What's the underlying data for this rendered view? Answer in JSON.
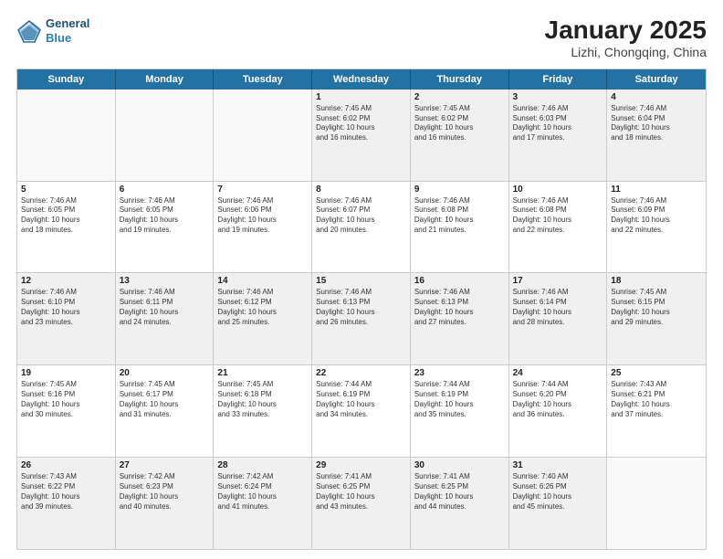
{
  "header": {
    "logo_line1": "General",
    "logo_line2": "Blue",
    "title": "January 2025",
    "subtitle": "Lizhi, Chongqing, China"
  },
  "calendar": {
    "days_of_week": [
      "Sunday",
      "Monday",
      "Tuesday",
      "Wednesday",
      "Thursday",
      "Friday",
      "Saturday"
    ],
    "weeks": [
      {
        "shaded": true,
        "cells": [
          {
            "day": "",
            "empty": true
          },
          {
            "day": "",
            "empty": true
          },
          {
            "day": "",
            "empty": true
          },
          {
            "day": "1",
            "line1": "Sunrise: 7:45 AM",
            "line2": "Sunset: 6:02 PM",
            "line3": "Daylight: 10 hours",
            "line4": "and 16 minutes."
          },
          {
            "day": "2",
            "line1": "Sunrise: 7:45 AM",
            "line2": "Sunset: 6:02 PM",
            "line3": "Daylight: 10 hours",
            "line4": "and 16 minutes."
          },
          {
            "day": "3",
            "line1": "Sunrise: 7:46 AM",
            "line2": "Sunset: 6:03 PM",
            "line3": "Daylight: 10 hours",
            "line4": "and 17 minutes."
          },
          {
            "day": "4",
            "line1": "Sunrise: 7:46 AM",
            "line2": "Sunset: 6:04 PM",
            "line3": "Daylight: 10 hours",
            "line4": "and 18 minutes."
          }
        ]
      },
      {
        "shaded": false,
        "cells": [
          {
            "day": "5",
            "line1": "Sunrise: 7:46 AM",
            "line2": "Sunset: 6:05 PM",
            "line3": "Daylight: 10 hours",
            "line4": "and 18 minutes."
          },
          {
            "day": "6",
            "line1": "Sunrise: 7:46 AM",
            "line2": "Sunset: 6:05 PM",
            "line3": "Daylight: 10 hours",
            "line4": "and 19 minutes."
          },
          {
            "day": "7",
            "line1": "Sunrise: 7:46 AM",
            "line2": "Sunset: 6:06 PM",
            "line3": "Daylight: 10 hours",
            "line4": "and 19 minutes."
          },
          {
            "day": "8",
            "line1": "Sunrise: 7:46 AM",
            "line2": "Sunset: 6:07 PM",
            "line3": "Daylight: 10 hours",
            "line4": "and 20 minutes."
          },
          {
            "day": "9",
            "line1": "Sunrise: 7:46 AM",
            "line2": "Sunset: 6:08 PM",
            "line3": "Daylight: 10 hours",
            "line4": "and 21 minutes."
          },
          {
            "day": "10",
            "line1": "Sunrise: 7:46 AM",
            "line2": "Sunset: 6:08 PM",
            "line3": "Daylight: 10 hours",
            "line4": "and 22 minutes."
          },
          {
            "day": "11",
            "line1": "Sunrise: 7:46 AM",
            "line2": "Sunset: 6:09 PM",
            "line3": "Daylight: 10 hours",
            "line4": "and 22 minutes."
          }
        ]
      },
      {
        "shaded": true,
        "cells": [
          {
            "day": "12",
            "line1": "Sunrise: 7:46 AM",
            "line2": "Sunset: 6:10 PM",
            "line3": "Daylight: 10 hours",
            "line4": "and 23 minutes."
          },
          {
            "day": "13",
            "line1": "Sunrise: 7:46 AM",
            "line2": "Sunset: 6:11 PM",
            "line3": "Daylight: 10 hours",
            "line4": "and 24 minutes."
          },
          {
            "day": "14",
            "line1": "Sunrise: 7:46 AM",
            "line2": "Sunset: 6:12 PM",
            "line3": "Daylight: 10 hours",
            "line4": "and 25 minutes."
          },
          {
            "day": "15",
            "line1": "Sunrise: 7:46 AM",
            "line2": "Sunset: 6:13 PM",
            "line3": "Daylight: 10 hours",
            "line4": "and 26 minutes."
          },
          {
            "day": "16",
            "line1": "Sunrise: 7:46 AM",
            "line2": "Sunset: 6:13 PM",
            "line3": "Daylight: 10 hours",
            "line4": "and 27 minutes."
          },
          {
            "day": "17",
            "line1": "Sunrise: 7:46 AM",
            "line2": "Sunset: 6:14 PM",
            "line3": "Daylight: 10 hours",
            "line4": "and 28 minutes."
          },
          {
            "day": "18",
            "line1": "Sunrise: 7:45 AM",
            "line2": "Sunset: 6:15 PM",
            "line3": "Daylight: 10 hours",
            "line4": "and 29 minutes."
          }
        ]
      },
      {
        "shaded": false,
        "cells": [
          {
            "day": "19",
            "line1": "Sunrise: 7:45 AM",
            "line2": "Sunset: 6:16 PM",
            "line3": "Daylight: 10 hours",
            "line4": "and 30 minutes."
          },
          {
            "day": "20",
            "line1": "Sunrise: 7:45 AM",
            "line2": "Sunset: 6:17 PM",
            "line3": "Daylight: 10 hours",
            "line4": "and 31 minutes."
          },
          {
            "day": "21",
            "line1": "Sunrise: 7:45 AM",
            "line2": "Sunset: 6:18 PM",
            "line3": "Daylight: 10 hours",
            "line4": "and 33 minutes."
          },
          {
            "day": "22",
            "line1": "Sunrise: 7:44 AM",
            "line2": "Sunset: 6:19 PM",
            "line3": "Daylight: 10 hours",
            "line4": "and 34 minutes."
          },
          {
            "day": "23",
            "line1": "Sunrise: 7:44 AM",
            "line2": "Sunset: 6:19 PM",
            "line3": "Daylight: 10 hours",
            "line4": "and 35 minutes."
          },
          {
            "day": "24",
            "line1": "Sunrise: 7:44 AM",
            "line2": "Sunset: 6:20 PM",
            "line3": "Daylight: 10 hours",
            "line4": "and 36 minutes."
          },
          {
            "day": "25",
            "line1": "Sunrise: 7:43 AM",
            "line2": "Sunset: 6:21 PM",
            "line3": "Daylight: 10 hours",
            "line4": "and 37 minutes."
          }
        ]
      },
      {
        "shaded": true,
        "cells": [
          {
            "day": "26",
            "line1": "Sunrise: 7:43 AM",
            "line2": "Sunset: 6:22 PM",
            "line3": "Daylight: 10 hours",
            "line4": "and 39 minutes."
          },
          {
            "day": "27",
            "line1": "Sunrise: 7:42 AM",
            "line2": "Sunset: 6:23 PM",
            "line3": "Daylight: 10 hours",
            "line4": "and 40 minutes."
          },
          {
            "day": "28",
            "line1": "Sunrise: 7:42 AM",
            "line2": "Sunset: 6:24 PM",
            "line3": "Daylight: 10 hours",
            "line4": "and 41 minutes."
          },
          {
            "day": "29",
            "line1": "Sunrise: 7:41 AM",
            "line2": "Sunset: 6:25 PM",
            "line3": "Daylight: 10 hours",
            "line4": "and 43 minutes."
          },
          {
            "day": "30",
            "line1": "Sunrise: 7:41 AM",
            "line2": "Sunset: 6:25 PM",
            "line3": "Daylight: 10 hours",
            "line4": "and 44 minutes."
          },
          {
            "day": "31",
            "line1": "Sunrise: 7:40 AM",
            "line2": "Sunset: 6:26 PM",
            "line3": "Daylight: 10 hours",
            "line4": "and 45 minutes."
          },
          {
            "day": "",
            "empty": true
          }
        ]
      }
    ]
  }
}
